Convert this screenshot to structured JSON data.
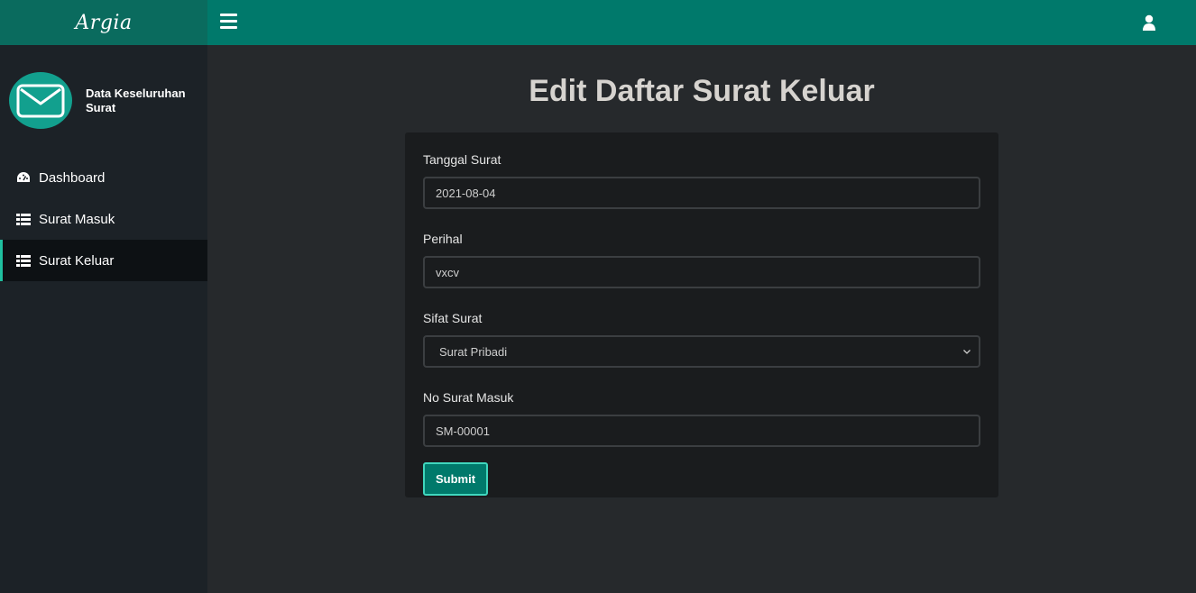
{
  "brand": {
    "name": "Argia"
  },
  "header": {
    "menu_icon": "hamburger-icon",
    "user_icon": "user-icon"
  },
  "sidebar": {
    "profile_title": "Data Keseluruhan Surat",
    "items": [
      {
        "label": "Dashboard",
        "icon": "dashboard-icon",
        "active": false
      },
      {
        "label": "Surat Masuk",
        "icon": "table-icon",
        "active": false
      },
      {
        "label": "Surat Keluar",
        "icon": "table-icon",
        "active": true
      }
    ]
  },
  "main": {
    "title": "Edit Daftar Surat Keluar",
    "form": {
      "tanggal_label": "Tanggal Surat",
      "tanggal_value": "2021-08-04",
      "perihal_label": "Perihal",
      "perihal_value": "vxcv",
      "sifat_label": "Sifat Surat",
      "sifat_value": "Surat Pribadi",
      "no_label": "No Surat Masuk",
      "no_value": "SM-00001",
      "submit_label": "Submit"
    }
  },
  "colors": {
    "topbar": "#00796b",
    "brand_bg": "#0a6b5e",
    "sidebar": "#1c2227",
    "main_bg": "#26292c",
    "accent": "#1fbf9f"
  }
}
